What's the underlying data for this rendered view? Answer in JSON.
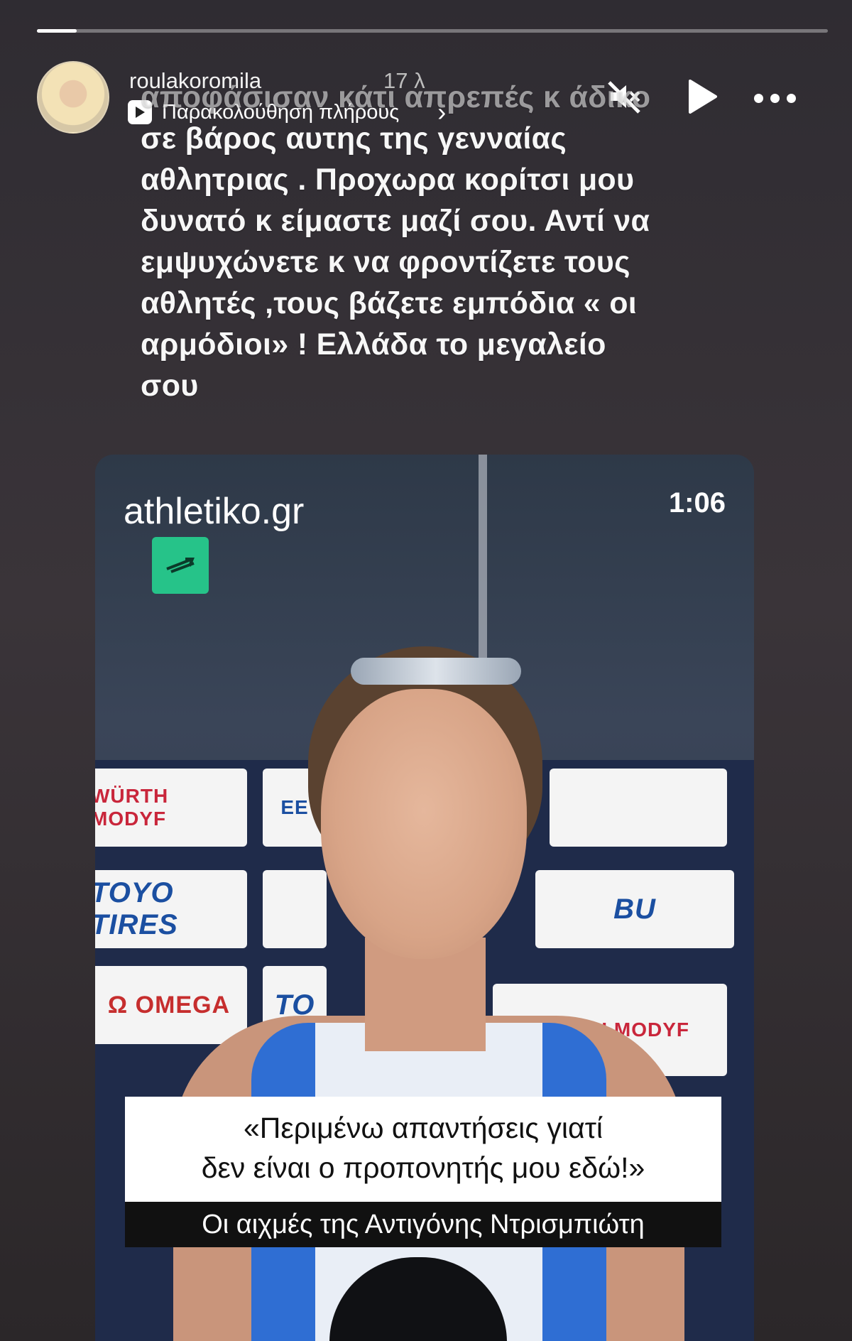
{
  "story": {
    "progress_fraction": 0.05,
    "username": "roulakoromila",
    "timestamp": "17 λ",
    "watch_full_label": "Παρακολούθηση πλήρους"
  },
  "caption": {
    "lines": [
      "αποφάσισαν κάτι απρεπές κ άδικο",
      "σε βάρος αυτης της γενναίας",
      "αθλητριας . Προχωρα κορίτσι μου",
      "δυνατό κ είμαστε μαζί σου. Αντί να",
      "εμψυχώνετε κ να φροντίζετε τους",
      "αθλητές ,τους βάζετε εμπόδια « οι",
      "αρμόδιοι» ! Ελλάδα το μεγαλείο",
      "σου"
    ]
  },
  "video": {
    "brand": "athletiko.gr",
    "duration": "1:06",
    "sponsors": {
      "wurth": "WÜRTH MODYF",
      "toyo": "TOYO TIRES",
      "omega": "Ω OMEGA",
      "bu": "BU",
      "eb": "EE",
      "to": "TO",
      "wurth2": "WÜRTH MODYF"
    },
    "subtitle_line1": "«Περιμένω απαντήσεις γιατί",
    "subtitle_line2": "δεν είναι ο προπονητής μου εδώ!»",
    "subtitle_dark": "Οι αιχμές της Αντιγόνης Ντρισμπιώτη"
  },
  "icons": {
    "mute": "muted-speaker-icon",
    "play": "play-icon",
    "more": "more-options-icon"
  }
}
